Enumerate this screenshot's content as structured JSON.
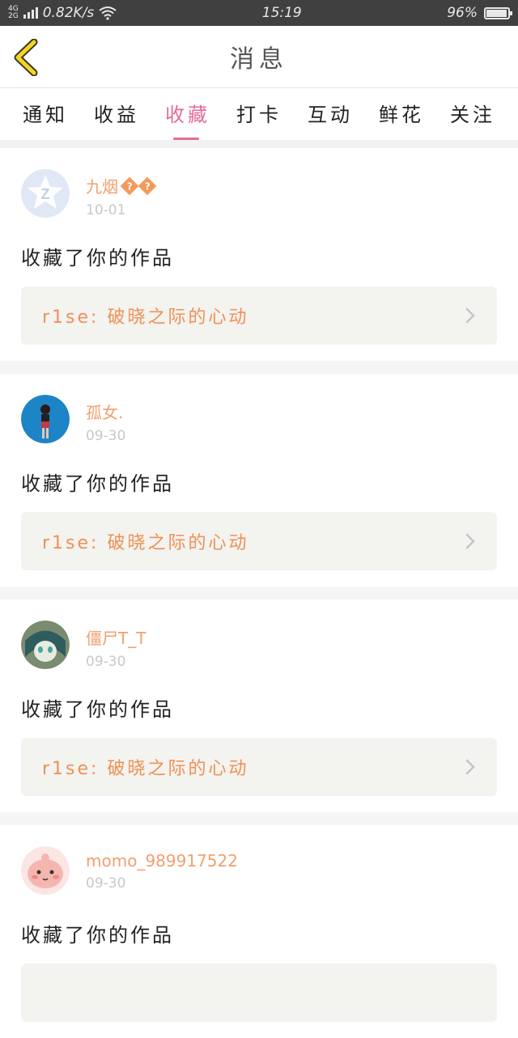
{
  "status": {
    "net_top": "4G",
    "net_bottom": "2G",
    "speed": "0.82K/s",
    "time": "15:19",
    "battery": "96%",
    "battery_level": 0.96
  },
  "header": {
    "title": "消息"
  },
  "tabs": [
    "通知",
    "收益",
    "收藏",
    "打卡",
    "互动",
    "鲜花",
    "关注"
  ],
  "active_tab": "收藏",
  "items": [
    {
      "name": "九烟",
      "date": "10-01",
      "action": "收藏了你的作品",
      "work": "r1se: 破晓之际的心动",
      "avatar": "qq-default-avatar",
      "badge": "?"
    },
    {
      "name": "孤女.",
      "date": "09-30",
      "action": "收藏了你的作品",
      "work": "r1se: 破晓之际的心动",
      "avatar": "girl-photo-avatar"
    },
    {
      "name": "僵尸T_T",
      "date": "09-30",
      "action": "收藏了你的作品",
      "work": "r1se: 破晓之际的心动",
      "avatar": "anime-avatar"
    },
    {
      "name": "momo_989917522",
      "date": "09-30",
      "action": "收藏了你的作品",
      "work": "",
      "avatar": "pink-cartoon-avatar"
    }
  ],
  "colors": {
    "accent": "#e46a9a",
    "username": "#f0a070",
    "work_title": "#f09055",
    "card_bg": "#f3f3ef"
  }
}
